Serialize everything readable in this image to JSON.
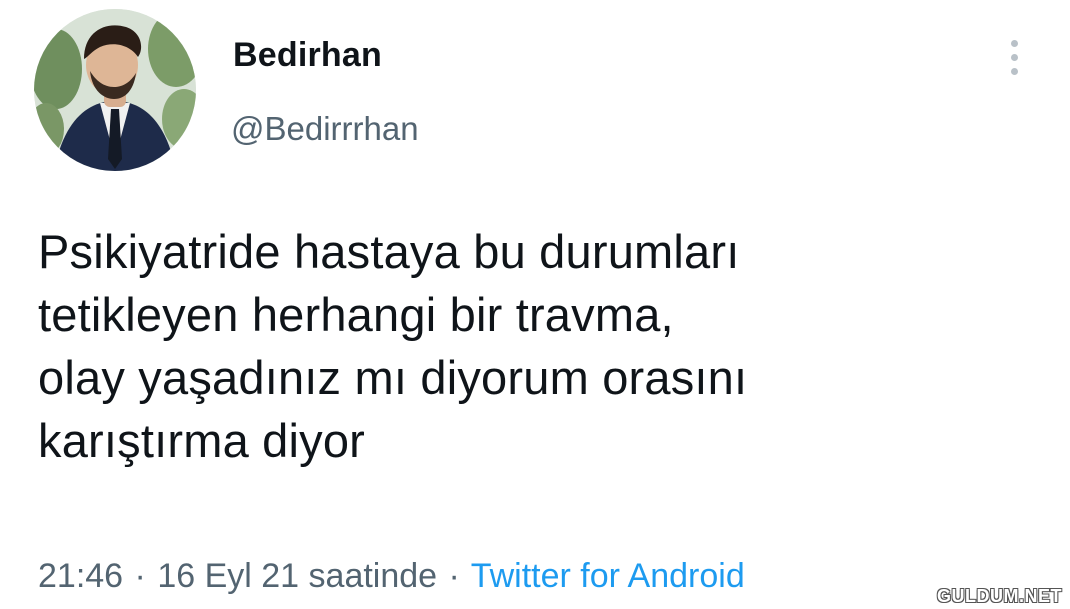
{
  "author": {
    "display_name": "Bedirhan",
    "handle": "@Bedirrrhan"
  },
  "tweet": {
    "text": "Psikiyatride hastaya bu durumları\ntetikleyen herhangi bir travma,\nolay yaşadınız mı diyorum orasını\nkarıştırma diyor"
  },
  "meta": {
    "time": "21:46",
    "separator": "·",
    "date": "16 Eyl 21 saatinde",
    "source": "Twitter for Android"
  },
  "watermark": "GULDUM.NET",
  "colors": {
    "text": "#0f1419",
    "secondary": "#536471",
    "link": "#1d9bf0"
  },
  "icons": {
    "more": "more-vertical-icon"
  }
}
